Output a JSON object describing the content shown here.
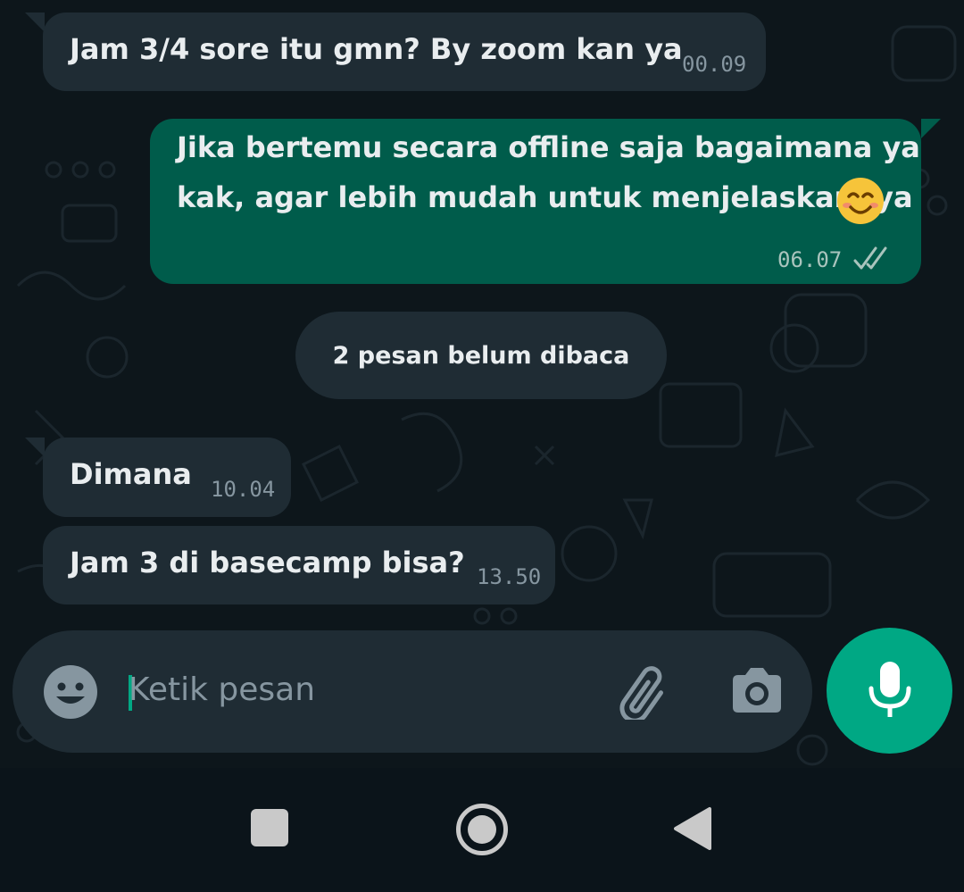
{
  "messages": [
    {
      "direction": "in",
      "text": "Jam 3/4 sore itu gmn? By zoom kan ya",
      "time": "00.09"
    },
    {
      "direction": "out",
      "text_line1": "Jika bertemu secara offline saja bagaimana ya",
      "text_line2": "kak, agar lebih mudah untuk menjelaskannya",
      "emoji": "smiling-face-emoji",
      "time": "06.07",
      "status": "delivered"
    },
    {
      "direction": "in",
      "text": "Dimana",
      "time": "10.04"
    },
    {
      "direction": "in",
      "text": "Jam 3 di basecamp bisa?",
      "time": "13.50"
    }
  ],
  "unread_banner": "2 pesan belum dibaca",
  "composer": {
    "placeholder": "Ketik pesan",
    "emoji_icon": "emoji-icon",
    "attach_icon": "paperclip-icon",
    "camera_icon": "camera-icon",
    "mic_icon": "mic-icon"
  },
  "nav": {
    "recents_icon": "square-icon",
    "home_icon": "circle-icon",
    "back_icon": "triangle-back-icon"
  },
  "colors": {
    "background": "#0b141a",
    "incoming_bubble": "#1f2c34",
    "outgoing_bubble": "#005c4b",
    "accent": "#00a884",
    "text": "#e9edef",
    "meta": "#8696a0"
  }
}
